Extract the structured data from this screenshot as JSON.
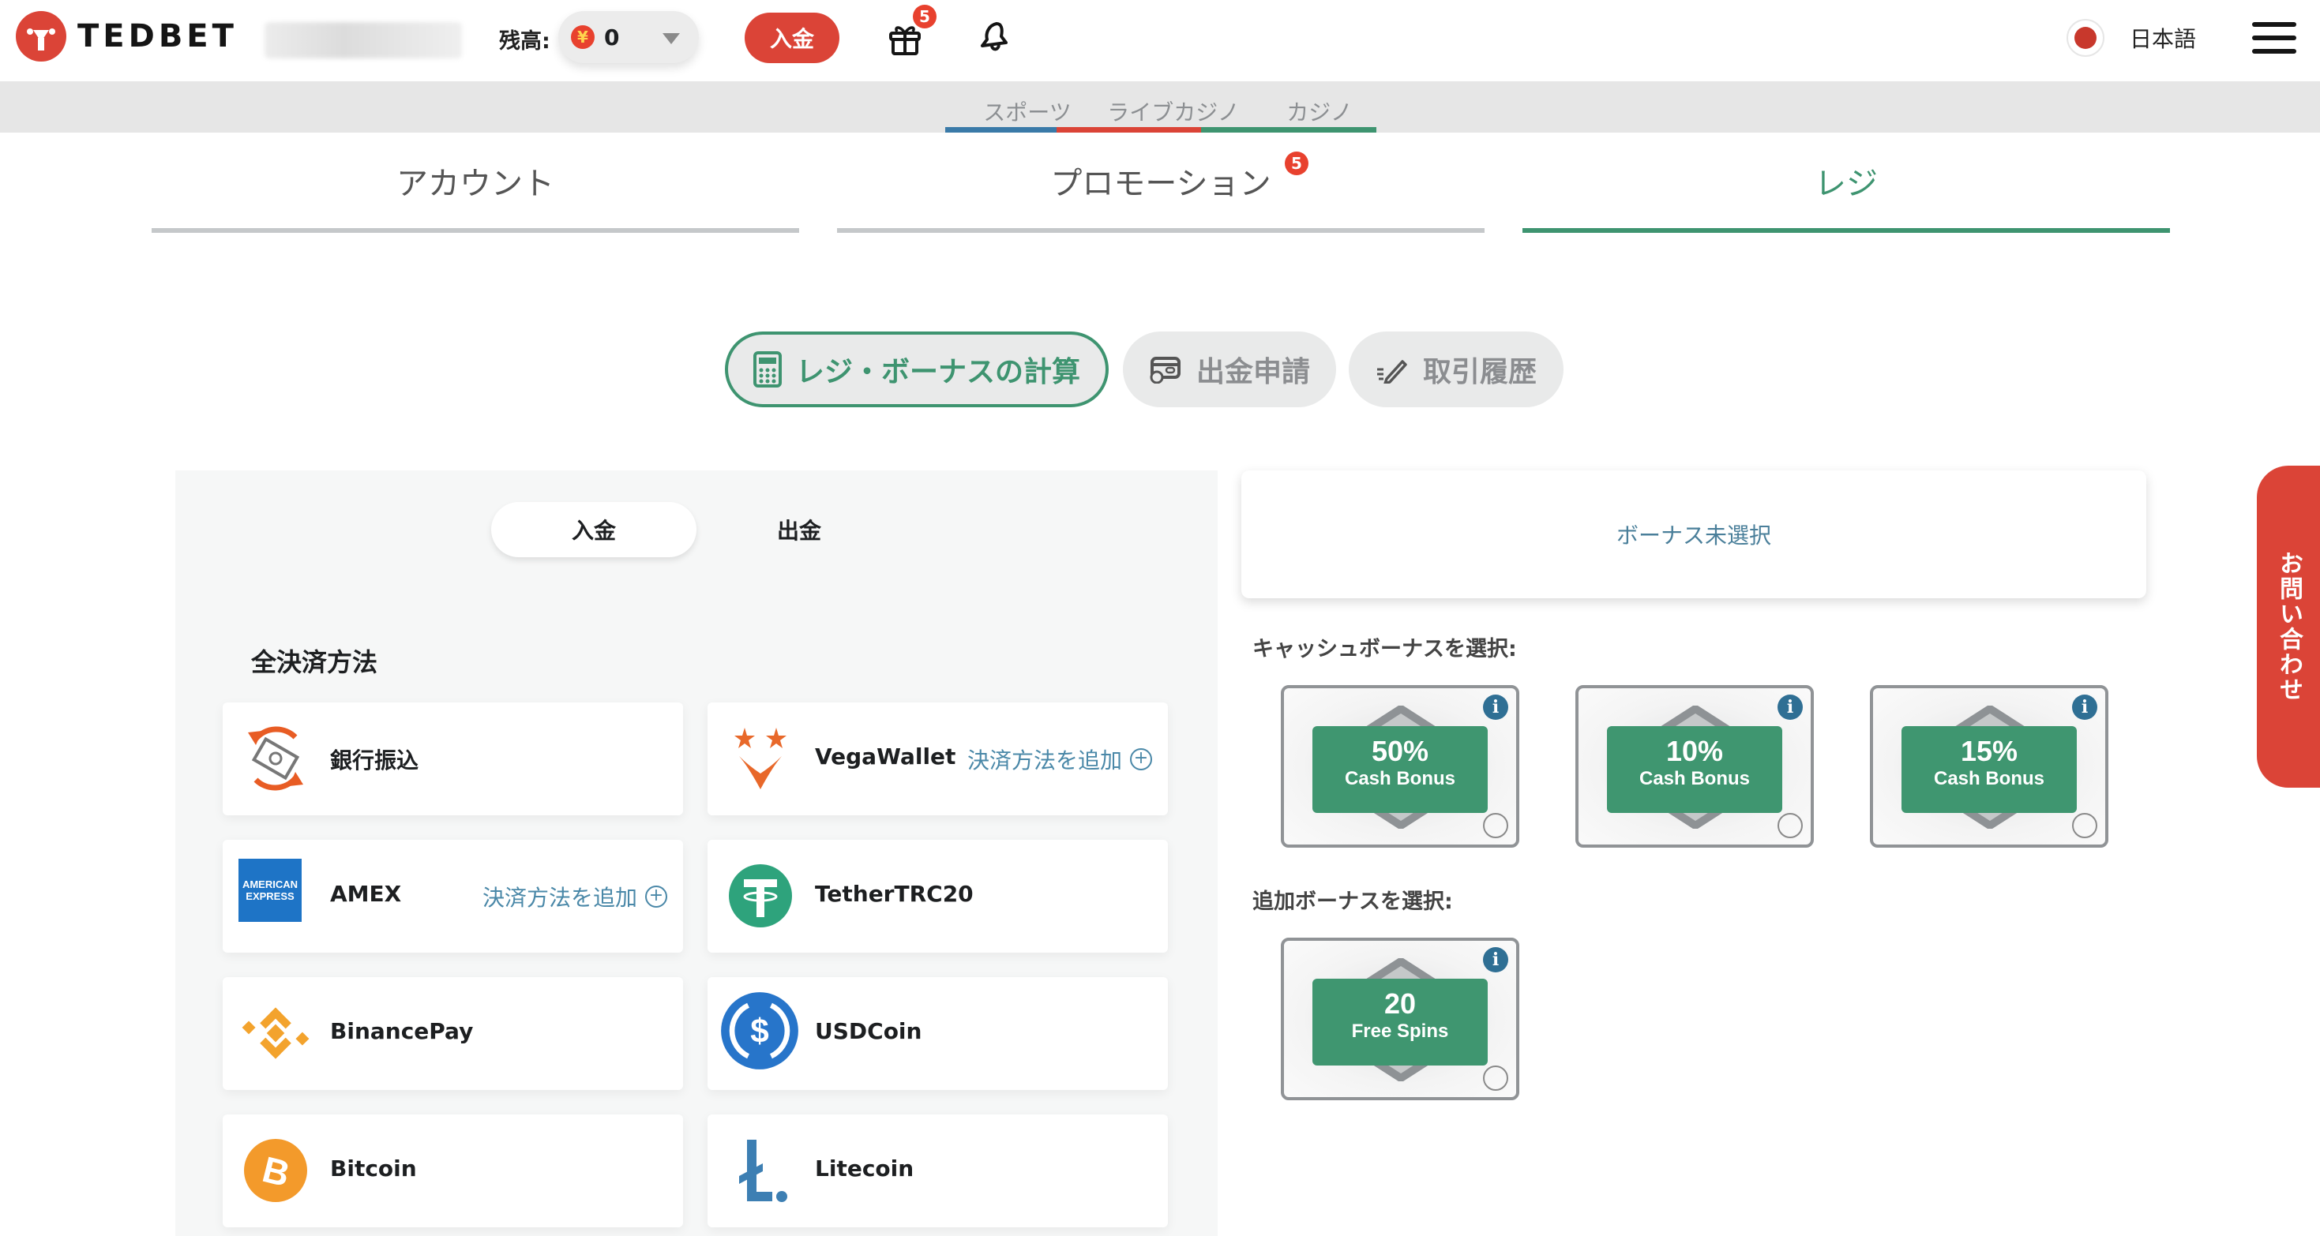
{
  "header": {
    "brand": "TEDBET",
    "balance_label": "残高:",
    "balance_value": "0",
    "currency_symbol": "¥",
    "deposit_button": "入金",
    "gift_badge_count": "5",
    "language": "日本語"
  },
  "categories": [
    {
      "label": "スポーツ",
      "color": "#3a7aa8"
    },
    {
      "label": "ライブカジノ",
      "color": "#db4437"
    },
    {
      "label": "カジノ",
      "color": "#3e9470"
    }
  ],
  "account_tabs": [
    {
      "label": "アカウント",
      "active": false
    },
    {
      "label": "プロモーション",
      "active": false,
      "badge": "5"
    },
    {
      "label": "レジ",
      "active": true
    }
  ],
  "cashier_tabs": [
    {
      "label": "レジ・ボーナスの計算",
      "icon": "calculator-icon",
      "active": true
    },
    {
      "label": "出金申請",
      "icon": "card-clock-icon",
      "active": false
    },
    {
      "label": "取引履歴",
      "icon": "pencil-icon",
      "active": false
    }
  ],
  "payment": {
    "toggle": [
      {
        "label": "入金",
        "active": true
      },
      {
        "label": "出金",
        "active": false
      }
    ],
    "section_title": "全決済方法",
    "add_method_label": "決済方法を追加",
    "methods": [
      {
        "name": "銀行振込",
        "icon": "bank-transfer-icon",
        "add_method": false
      },
      {
        "name": "VegaWallet",
        "icon": "vegawallet-icon",
        "add_method": true
      },
      {
        "name": "AMEX",
        "icon": "amex-icon",
        "add_method": true
      },
      {
        "name": "TetherTRC20",
        "icon": "tether-icon",
        "add_method": false
      },
      {
        "name": "BinancePay",
        "icon": "binance-icon",
        "add_method": false
      },
      {
        "name": "USDCoin",
        "icon": "usdc-icon",
        "add_method": false
      },
      {
        "name": "Bitcoin",
        "icon": "bitcoin-icon",
        "add_method": false
      },
      {
        "name": "Litecoin",
        "icon": "litecoin-icon",
        "add_method": false
      }
    ],
    "amex_logo_lines": [
      "AMERICAN",
      "EXPRESS"
    ]
  },
  "bonus": {
    "selected_display": "ボーナス未選択",
    "cash_label": "キャッシュボーナスを選択:",
    "cash_bonuses": [
      {
        "value": "50%",
        "type": "Cash Bonus",
        "selected": false
      },
      {
        "value": "10%",
        "type": "Cash Bonus",
        "selected": false
      },
      {
        "value": "15%",
        "type": "Cash Bonus",
        "selected": false
      }
    ],
    "extra_label": "追加ボーナスを選択:",
    "extra_bonuses": [
      {
        "value": "20",
        "type": "Free Spins",
        "selected": false
      }
    ],
    "info_glyph": "i"
  },
  "contact": {
    "label": "お問い合わせ"
  }
}
